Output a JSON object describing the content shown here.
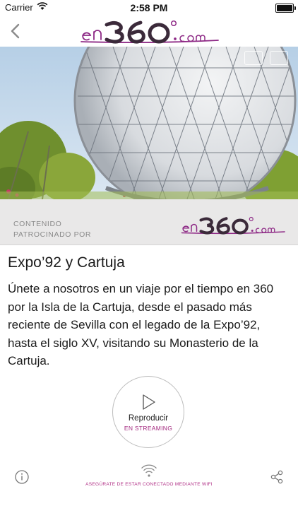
{
  "status_bar": {
    "carrier": "Carrier",
    "time": "2:58 PM"
  },
  "nav": {
    "logo_alt": "en360.com"
  },
  "sponsor": {
    "label_line1": "CONTENIDO",
    "label_line2": "PATROCINADO POR"
  },
  "content": {
    "title": "Expo’92 y Cartuja",
    "description": "Únete a nosotros en un viaje por el tiempo en 360 por la Isla de la Cartuja, desde el pasado más reciente de Sevilla con el legado de la Expo’92, hasta el siglo XV, visitando su Monasterio de la Cartuja."
  },
  "play": {
    "label": "Reproducir",
    "sublabel": "EN STREAMING"
  },
  "footer": {
    "wifi_notice": "ASEGÚRATE DE ESTAR CONECTADO MEDIANTE WIFI"
  },
  "colors": {
    "brand": "#8e2a86",
    "sponsor_bg": "#e9e8e8",
    "accent": "#a3297f"
  }
}
